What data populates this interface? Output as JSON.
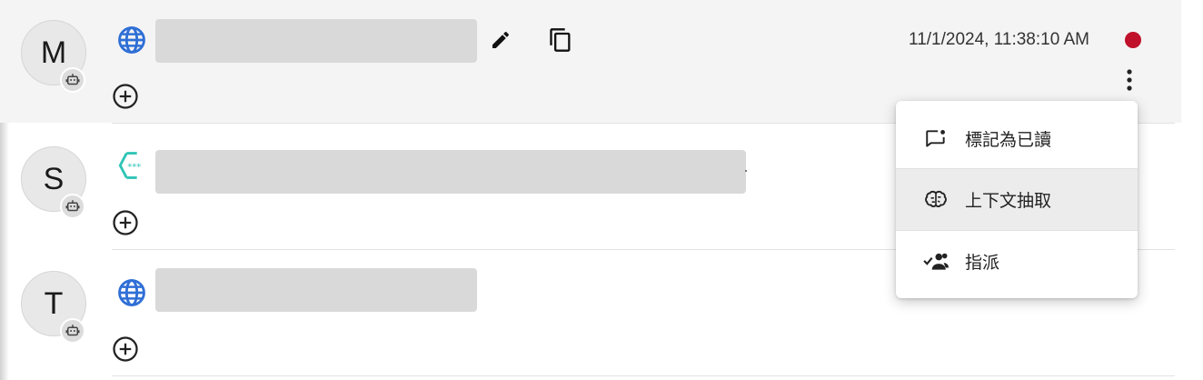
{
  "colors": {
    "row_highlight": "#f4f4f4",
    "status_dot_unread": "#c0102a",
    "globe_icon": "#2f6fd6",
    "hex_logo": "#2ec4b6",
    "redaction": "#d9d9d9"
  },
  "conversations": [
    {
      "avatar_letter": "M",
      "source_icon": "globe-icon",
      "timestamp": "11/1/2024, 11:38:10 AM",
      "status": "unread",
      "has_edit": true,
      "has_copy": true
    },
    {
      "avatar_letter": "S",
      "source_icon": "hexagon-logo-icon",
      "timestamp": "",
      "status": "",
      "has_edit": false,
      "has_copy": false
    },
    {
      "avatar_letter": "T",
      "source_icon": "globe-icon",
      "timestamp": "",
      "status": "",
      "has_edit": false,
      "has_copy": false
    }
  ],
  "context_menu": {
    "items": [
      {
        "label": "標記為已讀",
        "icon": "mark-read-icon"
      },
      {
        "label": "上下文抽取",
        "icon": "brain-icon"
      },
      {
        "label": "指派",
        "icon": "assign-people-icon"
      }
    ],
    "active_index": 1
  }
}
